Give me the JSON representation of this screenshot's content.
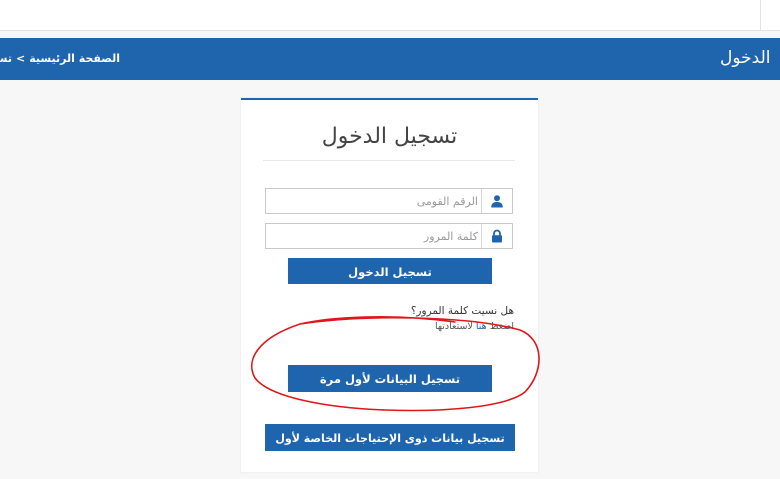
{
  "header": {
    "page_title": "الدخول",
    "breadcrumb": {
      "home": "الصفحة الرئيسية",
      "separator": ">",
      "current": "تسج"
    }
  },
  "login_panel": {
    "heading": "تسجيل الدخول",
    "national_id_placeholder": "الرقم القومى",
    "password_placeholder": "كلمة المرور",
    "login_button": "تسجيل الدخول",
    "forgot_question": "هل نسيت كلمة المرور؟",
    "forgot_link_prefix": "اضغط",
    "forgot_link_here": "هنا",
    "forgot_link_suffix": "لاستعادتها",
    "first_time_button": "تسجيل البيانات لأول مرة",
    "special_needs_button": "تسجيل بيانات ذوى الإحتياجات الخاصة لأول مرة"
  },
  "colors": {
    "primary": "#1f65ad",
    "annotation": "#e0161b"
  },
  "icons": {
    "user": "user-icon",
    "lock": "lock-icon"
  }
}
